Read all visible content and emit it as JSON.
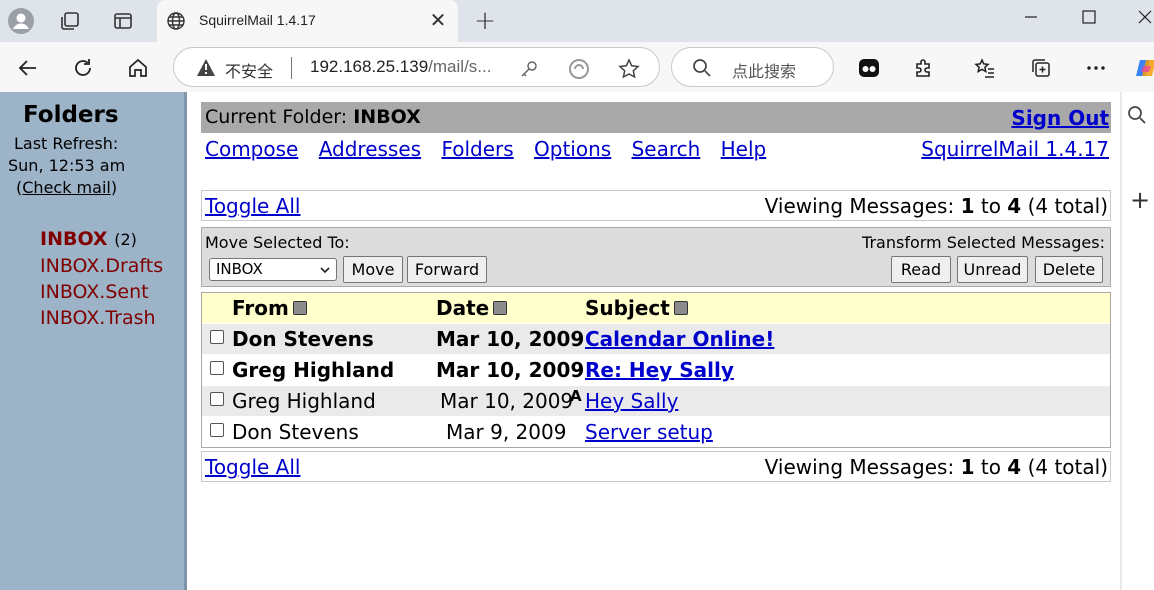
{
  "browser": {
    "tab_title": "SquirrelMail 1.4.17",
    "address_security": "不安全",
    "url_host": "192.168.25.139",
    "url_path": "/mail/s...",
    "search_placeholder": "点此搜索"
  },
  "sidebar": {
    "title": "Folders",
    "last_refresh_label": "Last Refresh:",
    "refresh_time": "Sun, 12:53 am",
    "check_mail_open": "(",
    "check_mail": "Check mail",
    "check_mail_close": ")",
    "folders": [
      {
        "name": "INBOX",
        "count": "(2)"
      },
      {
        "name": "INBOX.Drafts"
      },
      {
        "name": "INBOX.Sent"
      },
      {
        "name": "INBOX.Trash"
      }
    ]
  },
  "header": {
    "current_folder_label": "Current Folder: ",
    "current_folder": "INBOX",
    "sign_out": "Sign Out",
    "nav": [
      "Compose",
      "Addresses",
      "Folders",
      "Options",
      "Search",
      "Help"
    ],
    "version": "SquirrelMail 1.4.17"
  },
  "list": {
    "toggle_all": "Toggle All",
    "viewing_prefix": "Viewing Messages: ",
    "viewing_from": "1",
    "viewing_to_word": " to ",
    "viewing_to": "4",
    "viewing_total": " (4 total)",
    "move_label": "Move Selected To:",
    "move_target": "INBOX",
    "move_button": "Move",
    "forward_button": "Forward",
    "transform_label": "Transform Selected Messages:",
    "read_button": "Read",
    "unread_button": "Unread",
    "delete_button": "Delete",
    "columns": [
      "From",
      "Date",
      "Subject"
    ],
    "messages": [
      {
        "from": "Don Stevens",
        "date": "Mar 10, 2009",
        "subject": "Calendar Online!",
        "flag": "",
        "unread": true
      },
      {
        "from": "Greg Highland",
        "date": "Mar 10, 2009",
        "subject": "Re: Hey Sally",
        "flag": "",
        "unread": true
      },
      {
        "from": "Greg Highland",
        "date": "Mar 10, 2009",
        "subject": "Hey Sally",
        "flag": "A",
        "unread": false
      },
      {
        "from": "Don Stevens",
        "date": "Mar 9, 2009",
        "subject": "Server setup",
        "flag": "",
        "unread": false
      }
    ]
  },
  "colors": {
    "sidebar_bg": "#9cb3c8",
    "folder_link": "#800000",
    "header_bar": "#a9a9a9",
    "column_header": "#ffffcc",
    "link": "#0000cc"
  }
}
